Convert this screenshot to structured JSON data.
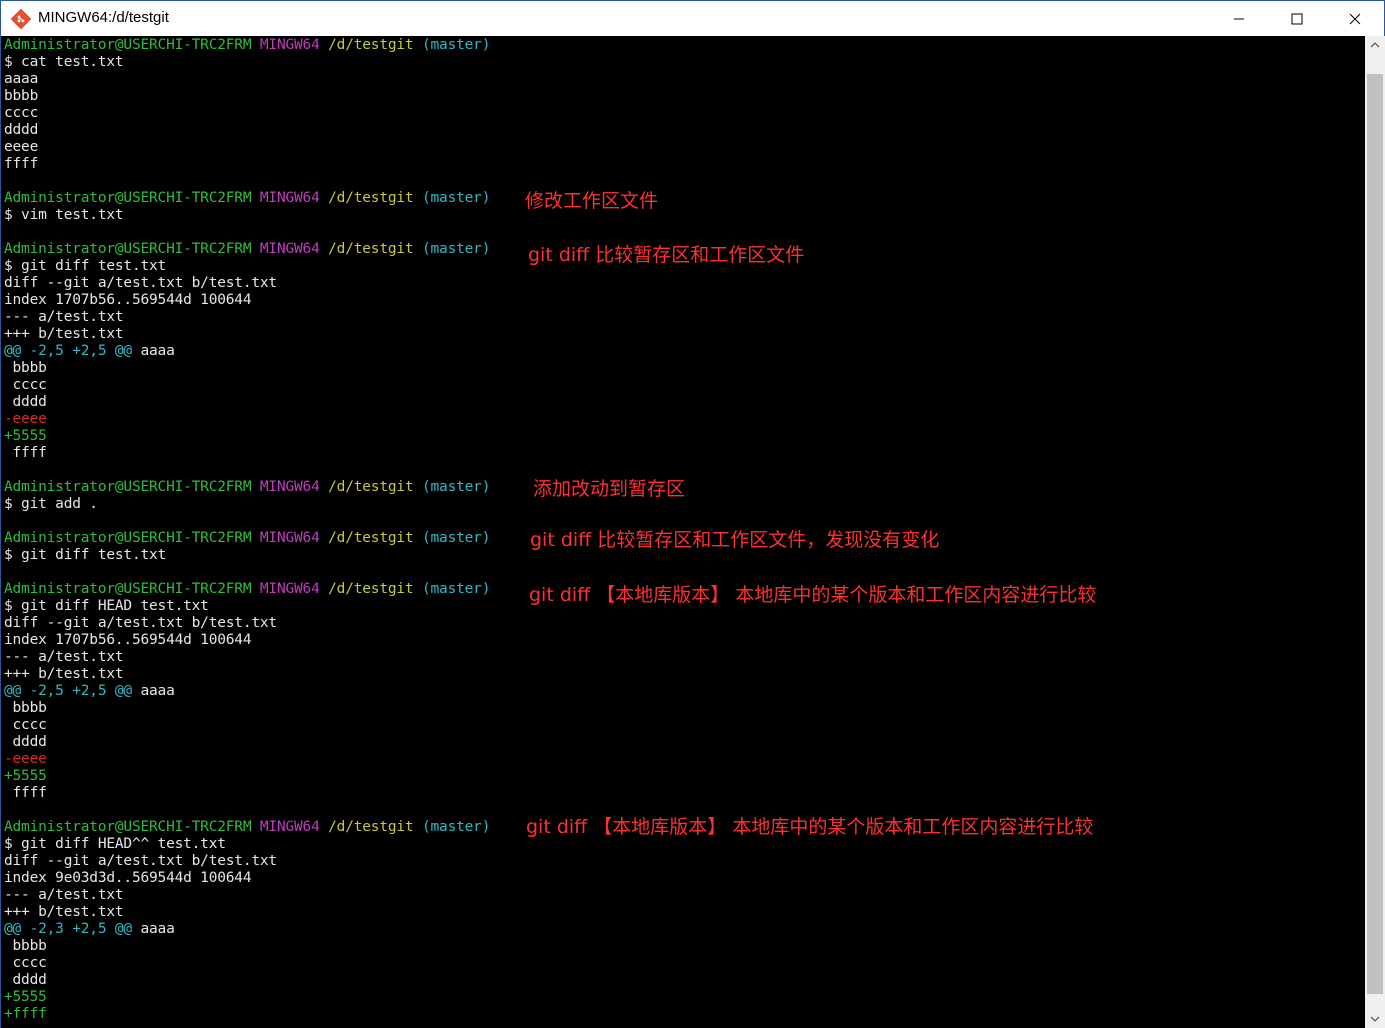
{
  "window": {
    "title": "MINGW64:/d/testgit"
  },
  "prompt": {
    "user": "Administrator@USERCHI-TRC2FRM",
    "env": "MINGW64",
    "path": "/d/testgit",
    "branch": "(master)"
  },
  "lines": {
    "l1_cmd": "$ cat test.txt",
    "l1_o1": "aaaa",
    "l1_o2": "bbbb",
    "l1_o3": "cccc",
    "l1_o4": "dddd",
    "l1_o5": "eeee",
    "l1_o6": "ffff",
    "l2_cmd": "$ vim test.txt",
    "l3_cmd": "$ git diff test.txt",
    "l3_d1": "diff --git a/test.txt b/test.txt",
    "l3_d2": "index 1707b56..569544d 100644",
    "l3_d3": "--- a/test.txt",
    "l3_d4": "+++ b/test.txt",
    "l3_hunk": "@@ -2,5 +2,5 @@",
    "l3_hunk_ctx": " aaaa",
    "l3_c1": " bbbb",
    "l3_c2": " cccc",
    "l3_c3": " dddd",
    "l3_del": "-eeee",
    "l3_add": "+5555",
    "l3_c4": " ffff",
    "l4_cmd": "$ git add .",
    "l5_cmd": "$ git diff test.txt",
    "l6_cmd": "$ git diff HEAD test.txt",
    "l6_d1": "diff --git a/test.txt b/test.txt",
    "l6_d2": "index 1707b56..569544d 100644",
    "l6_d3": "--- a/test.txt",
    "l6_d4": "+++ b/test.txt",
    "l6_hunk": "@@ -2,5 +2,5 @@",
    "l6_hunk_ctx": " aaaa",
    "l6_c1": " bbbb",
    "l6_c2": " cccc",
    "l6_c3": " dddd",
    "l6_del": "-eeee",
    "l6_add": "+5555",
    "l6_c4": " ffff",
    "l7_cmd": "$ git diff HEAD^^ test.txt",
    "l7_d1": "diff --git a/test.txt b/test.txt",
    "l7_d2": "index 9e03d3d..569544d 100644",
    "l7_d3": "--- a/test.txt",
    "l7_d4": "+++ b/test.txt",
    "l7_hunk": "@@ -2,3 +2,5 @@",
    "l7_hunk_ctx": " aaaa",
    "l7_c1": " bbbb",
    "l7_c2": " cccc",
    "l7_c3": " dddd",
    "l7_add1": "+5555",
    "l7_add2": "+ffff"
  },
  "notes": {
    "n1": "修改工作区文件",
    "n2": "git diff 比较暂存区和工作区文件",
    "n3": "添加改动到暂存区",
    "n4": "git diff 比较暂存区和工作区文件，发现没有变化",
    "n5": "git diff 【本地库版本】 本地库中的某个版本和工作区内容进行比较",
    "n6": "git diff 【本地库版本】 本地库中的某个版本和工作区内容进行比较"
  },
  "colors": {
    "prompt_user": "#2fbc3d",
    "prompt_env": "#c13cbf",
    "prompt_path": "#c6c93a",
    "prompt_branch": "#2fb9c4",
    "diff_hunk": "#2fb9c4",
    "diff_del": "#d12d2d",
    "diff_add": "#2fbc3d",
    "note": "#ff3030"
  },
  "icons": {
    "app": "git-bash-icon",
    "minimize": "minimize-icon",
    "maximize": "maximize-icon",
    "close": "close-icon",
    "scroll_up": "scroll-up-arrow-icon",
    "scroll_down": "scroll-down-arrow-icon"
  }
}
